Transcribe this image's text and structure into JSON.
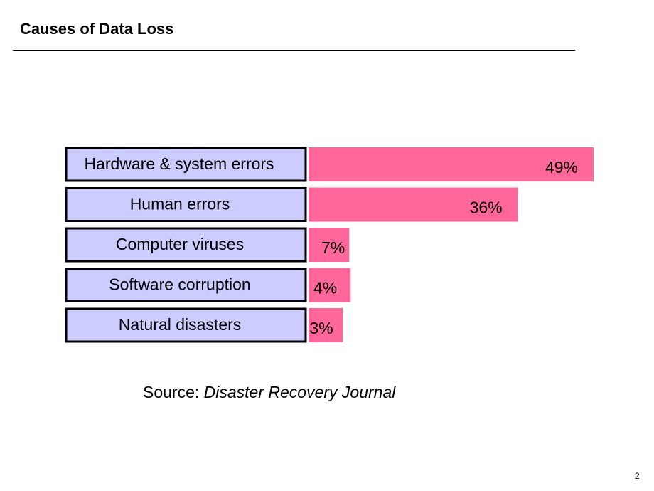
{
  "slide": {
    "title": "Causes of Data Loss",
    "source_prefix": "Source: ",
    "source_name": "Disaster Recovery Journal",
    "page_number": "2"
  },
  "colors": {
    "label_box_fill": "#ccccff",
    "label_box_border": "#000000",
    "bar_fill": "#ff6699"
  },
  "chart_data": {
    "type": "bar",
    "orientation": "horizontal",
    "title": "Causes of Data Loss",
    "categories": [
      "Hardware & system errors",
      "Human errors",
      "Computer viruses",
      "Software corruption",
      "Natural disasters"
    ],
    "values": [
      49,
      36,
      7,
      4,
      3
    ],
    "value_labels": [
      "49%",
      "36%",
      "7%",
      "4%",
      "3%"
    ],
    "unit": "%",
    "xlabel": "",
    "ylabel": "",
    "xlim": [
      0,
      49
    ],
    "grid": false,
    "legend": "none",
    "annotation": "Source: Disaster Recovery Journal"
  }
}
